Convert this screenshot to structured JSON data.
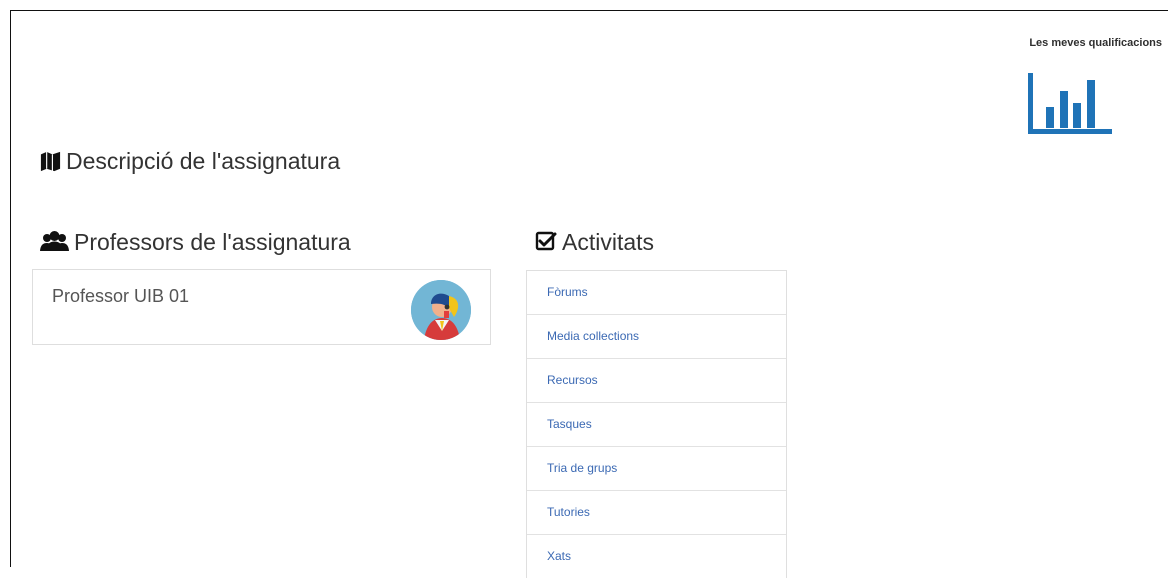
{
  "header": {
    "grades_label": "Les meves qualificacions"
  },
  "sections": {
    "description_title": "Descripció de l'assignatura",
    "professors_title": "Professors de l'assignatura",
    "activities_title": "Activitats"
  },
  "professors": [
    {
      "name": "Professor UIB 01"
    }
  ],
  "activities": [
    {
      "label": "Fòrums"
    },
    {
      "label": "Media collections"
    },
    {
      "label": "Recursos"
    },
    {
      "label": "Tasques"
    },
    {
      "label": "Tria de grups"
    },
    {
      "label": "Tutories"
    },
    {
      "label": "Xats"
    }
  ],
  "icons": {
    "grades": "bar-chart-icon",
    "description": "map-icon",
    "professors": "users-icon",
    "activities": "check-square-icon",
    "avatar": "teacher-avatar"
  },
  "colors": {
    "accent": "#1f73b7",
    "link": "#3b69b3",
    "text": "#333333",
    "border": "#dfdfdf"
  }
}
